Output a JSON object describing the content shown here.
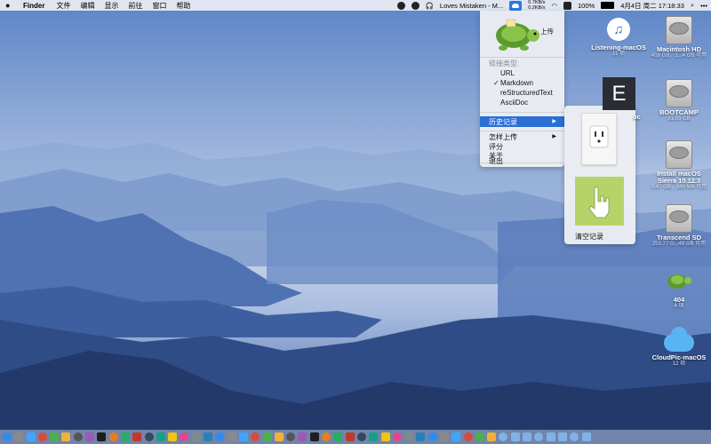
{
  "menubar": {
    "app_name": "Finder",
    "items": [
      "文件",
      "编辑",
      "显示",
      "前往",
      "窗口",
      "帮助"
    ],
    "now_playing": "Loves Mistaken - M...",
    "net_up": "0.7KB/s",
    "net_down": "0.2KB/s",
    "battery": "100%",
    "datetime": "4月4日 周二  17:18:33",
    "icons": [
      "apple-icon",
      "qq-icon",
      "circle-icon",
      "headphones-icon",
      "upload-cloud-icon",
      "wifi-icon",
      "input-method-icon",
      "battery-icon",
      "search-icon",
      "more-icon"
    ]
  },
  "menu": {
    "upload_label": "上传",
    "link_type_header": "链接类型:",
    "link_types": [
      "URL",
      "Markdown",
      "reStructuredText",
      "AsciiDoc"
    ],
    "checked_link_type": "Markdown",
    "history": "历史记录",
    "how_to_upload": "怎样上传",
    "rate": "评分",
    "about": "关于",
    "quit": "退出",
    "submenu_arrow": "▶",
    "check_mark": "✓"
  },
  "submenu": {
    "clear_history": "清空记录"
  },
  "desktop_icons": [
    {
      "name": "Listening-macOS",
      "sub": "11 项"
    },
    {
      "name": "Macintosh HD",
      "sub": "418 GB，1...4 GB 可用"
    },
    {
      "name": "BOOTCAMP",
      "sub": "81.03 GB"
    },
    {
      "name": "Install macOS\nSierra 10.12.3",
      "sub": "5.47 GB，349 MB 可用"
    },
    {
      "name": "Transcend SD",
      "sub": "253.77 G...48 GB 可用"
    },
    {
      "name": "404",
      "sub": "4 项"
    },
    {
      "name": "CloudPic-macOS",
      "sub": "12 项"
    }
  ],
  "e_app": {
    "letter": "E",
    "label_partial": "oc"
  },
  "colors": {
    "highlight": "#2b6fd6",
    "menu_bg": "#eceef2",
    "sky_top": "#5f86c6",
    "sky_mid": "#c9d6ea"
  }
}
